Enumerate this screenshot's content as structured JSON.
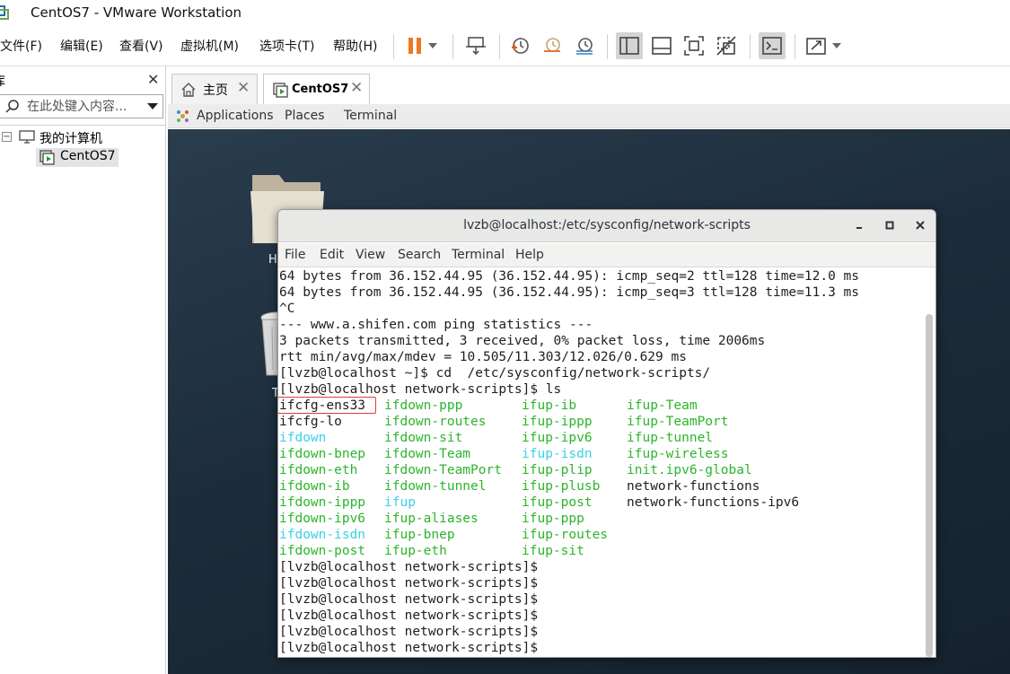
{
  "window": {
    "title": "CentOS7 - VMware Workstation"
  },
  "menu": {
    "items": [
      "文件(F)",
      "编辑(E)",
      "查看(V)",
      "虚拟机(M)",
      "选项卡(T)",
      "帮助(H)"
    ]
  },
  "toolbar": {
    "icons": [
      "pause-icon",
      "dropdown-icon",
      "send-keys-icon",
      "snapshot-icon",
      "revert-snapshot-icon",
      "snapshot-manager-icon",
      "library-view-icon",
      "thumbnail-view-icon",
      "fullscreen-icon",
      "unity-icon",
      "console-icon",
      "stretch-icon",
      "dropdown-icon"
    ]
  },
  "sidebar": {
    "title": "库",
    "search_placeholder": "在此处键入内容...",
    "tree": {
      "root": "我的计算机",
      "vm": "CentOS7"
    }
  },
  "tabs": [
    {
      "label": "主页",
      "icon": "home-icon",
      "active": false
    },
    {
      "label": "CentOS7",
      "icon": "vm-icon",
      "active": true
    }
  ],
  "guest": {
    "gnome_menu": [
      "Applications",
      "Places",
      "Terminal"
    ],
    "desktop_icons": {
      "home_label": "H",
      "trash_label": "T"
    }
  },
  "terminal": {
    "title": "lvzb@localhost:/etc/sysconfig/network-scripts",
    "window_buttons": [
      "_",
      "▢",
      "✕"
    ],
    "menu": [
      "File",
      "Edit",
      "View",
      "Search",
      "Terminal",
      "Help"
    ],
    "lines": [
      "64 bytes from 36.152.44.95 (36.152.44.95): icmp_seq=2 ttl=128 time=12.0 ms",
      "64 bytes from 36.152.44.95 (36.152.44.95): icmp_seq=3 ttl=128 time=11.3 ms",
      "^C",
      "--- www.a.shifen.com ping statistics ---",
      "3 packets transmitted, 3 received, 0% packet loss, time 2006ms",
      "rtt min/avg/max/mdev = 10.505/11.303/12.026/0.629 ms",
      "[lvzb@localhost ~]$ cd  /etc/sysconfig/network-scripts/",
      "[lvzb@localhost network-scripts]$ ls"
    ],
    "ls_rows": [
      [
        [
          "ifcfg-ens33",
          "d"
        ],
        [
          "ifdown-ppp",
          "g"
        ],
        [
          "ifup-ib",
          "g"
        ],
        [
          "ifup-Team",
          "g"
        ]
      ],
      [
        [
          "ifcfg-lo",
          "d"
        ],
        [
          "ifdown-routes",
          "g"
        ],
        [
          "ifup-ippp",
          "g"
        ],
        [
          "ifup-TeamPort",
          "g"
        ]
      ],
      [
        [
          "ifdown",
          "c"
        ],
        [
          "ifdown-sit",
          "g"
        ],
        [
          "ifup-ipv6",
          "g"
        ],
        [
          "ifup-tunnel",
          "g"
        ]
      ],
      [
        [
          "ifdown-bnep",
          "g"
        ],
        [
          "ifdown-Team",
          "g"
        ],
        [
          "ifup-isdn",
          "c"
        ],
        [
          "ifup-wireless",
          "g"
        ]
      ],
      [
        [
          "ifdown-eth",
          "g"
        ],
        [
          "ifdown-TeamPort",
          "g"
        ],
        [
          "ifup-plip",
          "g"
        ],
        [
          "init.ipv6-global",
          "g"
        ]
      ],
      [
        [
          "ifdown-ib",
          "g"
        ],
        [
          "ifdown-tunnel",
          "g"
        ],
        [
          "ifup-plusb",
          "g"
        ],
        [
          "network-functions",
          "d"
        ]
      ],
      [
        [
          "ifdown-ippp",
          "g"
        ],
        [
          "ifup",
          "c"
        ],
        [
          "ifup-post",
          "g"
        ],
        [
          "network-functions-ipv6",
          "d"
        ]
      ],
      [
        [
          "ifdown-ipv6",
          "g"
        ],
        [
          "ifup-aliases",
          "g"
        ],
        [
          "ifup-ppp",
          "g"
        ],
        [
          "",
          ""
        ]
      ],
      [
        [
          "ifdown-isdn",
          "c"
        ],
        [
          "ifup-bnep",
          "g"
        ],
        [
          "ifup-routes",
          "g"
        ],
        [
          "",
          ""
        ]
      ],
      [
        [
          "ifdown-post",
          "g"
        ],
        [
          "ifup-eth",
          "g"
        ],
        [
          "ifup-sit",
          "g"
        ],
        [
          "",
          ""
        ]
      ]
    ],
    "prompts": [
      "[lvzb@localhost network-scripts]$",
      "[lvzb@localhost network-scripts]$",
      "[lvzb@localhost network-scripts]$",
      "[lvzb@localhost network-scripts]$",
      "[lvzb@localhost network-scripts]$",
      "[lvzb@localhost network-scripts]$"
    ],
    "colors": {
      "green": "#2cb52c",
      "cyan": "#3cd0e8",
      "highlight_box": "#e03a3a"
    }
  }
}
